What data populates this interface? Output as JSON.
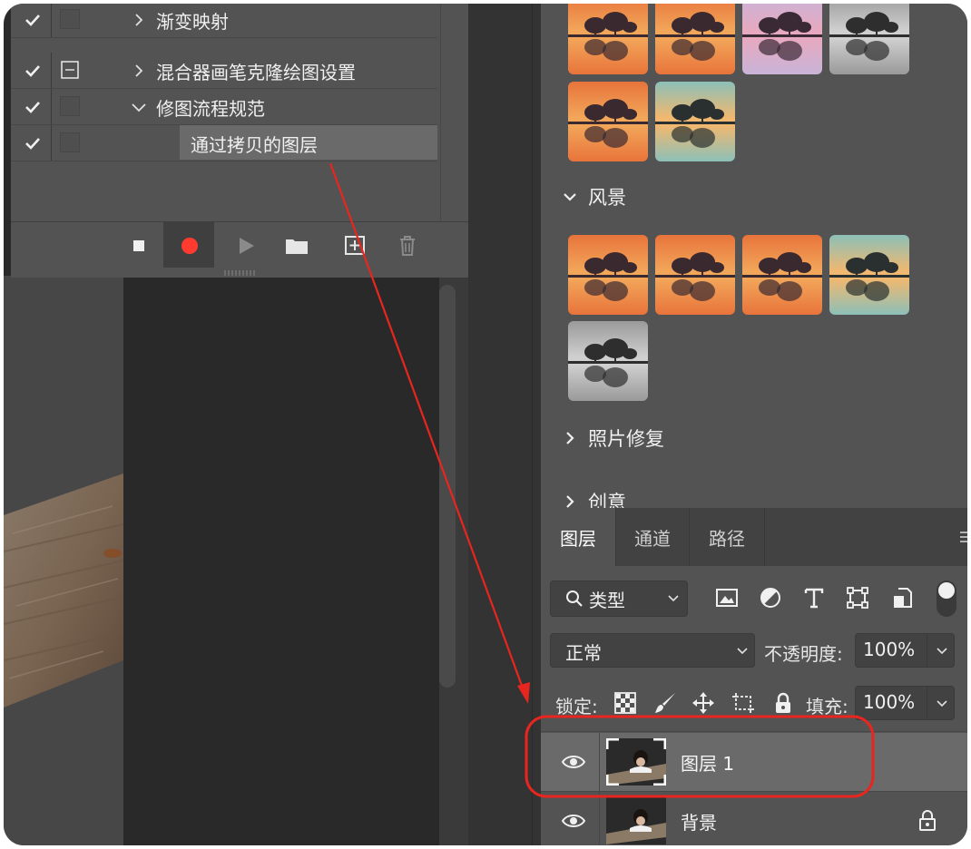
{
  "actions_panel": {
    "items": [
      {
        "label": "渐变映射",
        "checked": true,
        "expand": "collapsed",
        "has_dialog": false
      },
      {
        "label": "混合器画笔克隆绘图设置",
        "checked": true,
        "expand": "collapsed",
        "has_dialog": true
      },
      {
        "label": "修图流程规范",
        "checked": true,
        "expand": "expanded",
        "has_dialog": false
      },
      {
        "label": "通过拷贝的图层",
        "checked": true,
        "expand": "none",
        "has_dialog": false,
        "selected": true
      }
    ],
    "toolbar": [
      "stop-icon",
      "record-icon",
      "play-icon",
      "folder-icon",
      "new-action-icon",
      "trash-icon"
    ],
    "record_color": "#ff3b30"
  },
  "presets_panel": {
    "sections": [
      {
        "label": "风景",
        "state": "expanded"
      },
      {
        "label": "照片修复",
        "state": "collapsed"
      },
      {
        "label": "创意",
        "state": "collapsed"
      }
    ]
  },
  "layers_panel": {
    "tabs": [
      {
        "label": "图层",
        "active": true
      },
      {
        "label": "通道",
        "active": false
      },
      {
        "label": "路径",
        "active": false
      }
    ],
    "filter": {
      "label": "类型"
    },
    "filter_icons": [
      "image-filter-icon",
      "adjustment-filter-icon",
      "type-filter-icon",
      "shape-filter-icon",
      "smart-object-filter-icon",
      "filter-toggle-icon"
    ],
    "blend_mode": "正常",
    "opacity_label": "不透明度:",
    "opacity_value": "100%",
    "lock_label": "锁定:",
    "lock_icons": [
      "lock-transparent-icon",
      "lock-paint-icon",
      "lock-position-icon",
      "lock-artboard-icon",
      "lock-all-icon"
    ],
    "fill_label": "填充:",
    "fill_value": "100%",
    "layers": [
      {
        "name": "图层 1",
        "visible": true,
        "selected": true,
        "locked": false
      },
      {
        "name": "背景",
        "visible": true,
        "selected": false,
        "locked": true
      }
    ]
  },
  "annotation": {
    "color": "#e8261f"
  }
}
